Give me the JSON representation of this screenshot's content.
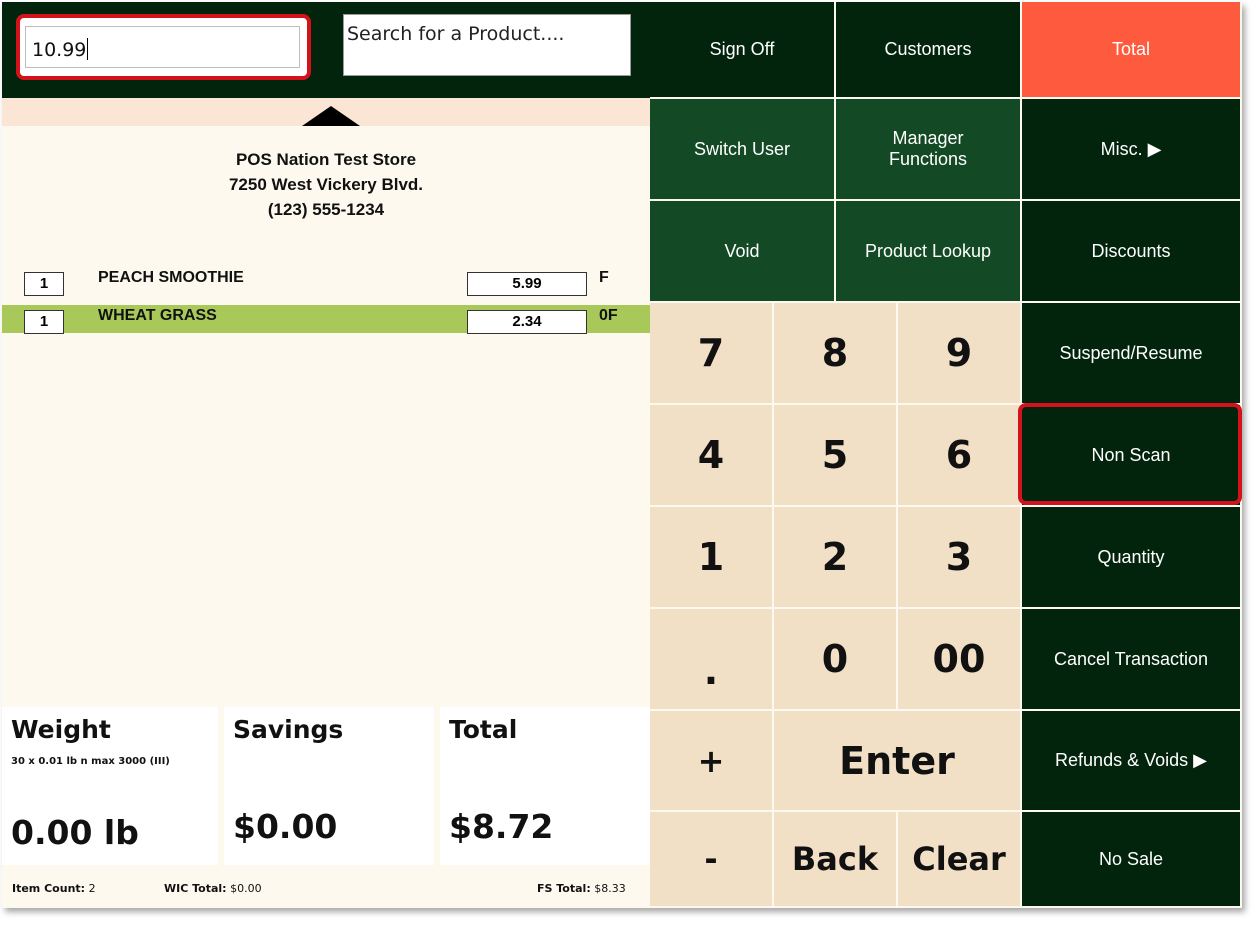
{
  "entry": {
    "value": "10.99"
  },
  "search": {
    "placeholder": "Search for a Product...."
  },
  "store": {
    "name": "POS Nation Test Store",
    "address": "7250 West Vickery Blvd.",
    "phone": "(123) 555-1234"
  },
  "items": [
    {
      "qty": "1",
      "name": "PEACH SMOOTHIE",
      "price": "5.99",
      "flag": "F",
      "selected": false
    },
    {
      "qty": "1",
      "name": "WHEAT GRASS",
      "price": "2.34",
      "flag": "0F",
      "selected": true
    }
  ],
  "panels": {
    "weight": {
      "title": "Weight",
      "sub": "30 x 0.01 lb n max 3000 (III)",
      "value": "0.00 lb"
    },
    "savings": {
      "title": "Savings",
      "value": "$0.00"
    },
    "total": {
      "title": "Total",
      "value": "$8.72"
    }
  },
  "footer": {
    "item_count_label": "Item Count:",
    "item_count": "2",
    "wic_label": "WIC Total:",
    "wic": "$0.00",
    "fs_label": "FS Total:",
    "fs": "$8.33"
  },
  "buttons": {
    "sign_off": "Sign Off",
    "customers": "Customers",
    "total": "Total",
    "switch_user": "Switch User",
    "manager_functions": "Manager Functions",
    "misc": "Misc. ▶",
    "void": "Void",
    "product_lookup": "Product Lookup",
    "discounts": "Discounts",
    "suspend_resume": "Suspend/Resume",
    "non_scan": "Non Scan",
    "quantity": "Quantity",
    "cancel_transaction": "Cancel Transaction",
    "refunds_voids": "Refunds & Voids ▶",
    "no_sale": "No Sale"
  },
  "keypad": {
    "k7": "7",
    "k8": "8",
    "k9": "9",
    "k4": "4",
    "k5": "5",
    "k6": "6",
    "k1": "1",
    "k2": "2",
    "k3": "3",
    "dot": ".",
    "k0": "0",
    "k00": "00",
    "plus": "+",
    "enter": "Enter",
    "minus": "-",
    "back": "Back",
    "clear": "Clear"
  },
  "colors": {
    "dark_green": "#03240c",
    "mid_green": "#134a25",
    "total_red": "#fe5a3e",
    "keypad_tan": "#f1dfc6",
    "selected_row": "#a8c95a",
    "highlight": "#d4121c"
  }
}
